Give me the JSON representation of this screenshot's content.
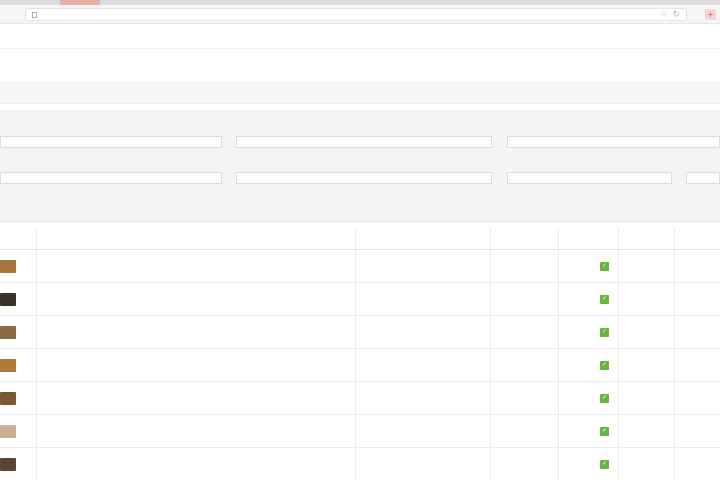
{
  "browser": {
    "url": "",
    "extension_icon": "+"
  },
  "admin": {
    "top_link": "",
    "breadcrumb": {
      "home": "",
      "link": ""
    },
    "notice": ""
  },
  "filters": [
    {
      "label": "",
      "value": ""
    },
    {
      "label": "",
      "value": ""
    },
    {
      "label": "",
      "value": ""
    },
    {
      "label": "",
      "value": ""
    },
    {
      "label": "",
      "value": ""
    },
    {
      "label": "",
      "value": ""
    },
    {
      "label": "",
      "value": ""
    }
  ],
  "table": {
    "columns": [
      {
        "key": "image",
        "label": ""
      },
      {
        "key": "name",
        "label": ""
      },
      {
        "key": "model",
        "label": ""
      },
      {
        "key": "quantity",
        "label": ""
      },
      {
        "key": "enabled",
        "label": ""
      },
      {
        "key": "status",
        "label": ""
      },
      {
        "key": "action",
        "label": ""
      }
    ],
    "rows": [
      {
        "thumb_color": "#a8743a",
        "name": "",
        "model": "",
        "quantity": "",
        "status": "",
        "action": ""
      },
      {
        "thumb_color": "#3b3226",
        "name": "",
        "model": "",
        "quantity": "",
        "status": "",
        "action": ""
      },
      {
        "thumb_color": "#8a6a40",
        "name": "",
        "model": "",
        "quantity": "",
        "status": "",
        "action": ""
      },
      {
        "thumb_color": "#b07a3c",
        "name": "",
        "model": "",
        "quantity": "",
        "status": "",
        "action": ""
      },
      {
        "thumb_color": "#7a5a30",
        "name": "",
        "model": "",
        "quantity": "",
        "status": "",
        "action": ""
      },
      {
        "thumb_color": "#c8b090",
        "name": "",
        "model": "",
        "quantity": "",
        "status": "",
        "action": ""
      },
      {
        "thumb_color": "#5a4530",
        "name": "",
        "model": "",
        "quantity": "",
        "status": "",
        "action": ""
      }
    ]
  },
  "colors": {
    "link": "#3f8ad0",
    "enabled_green": "#63b83a",
    "status_green": "#6cbb3c"
  }
}
